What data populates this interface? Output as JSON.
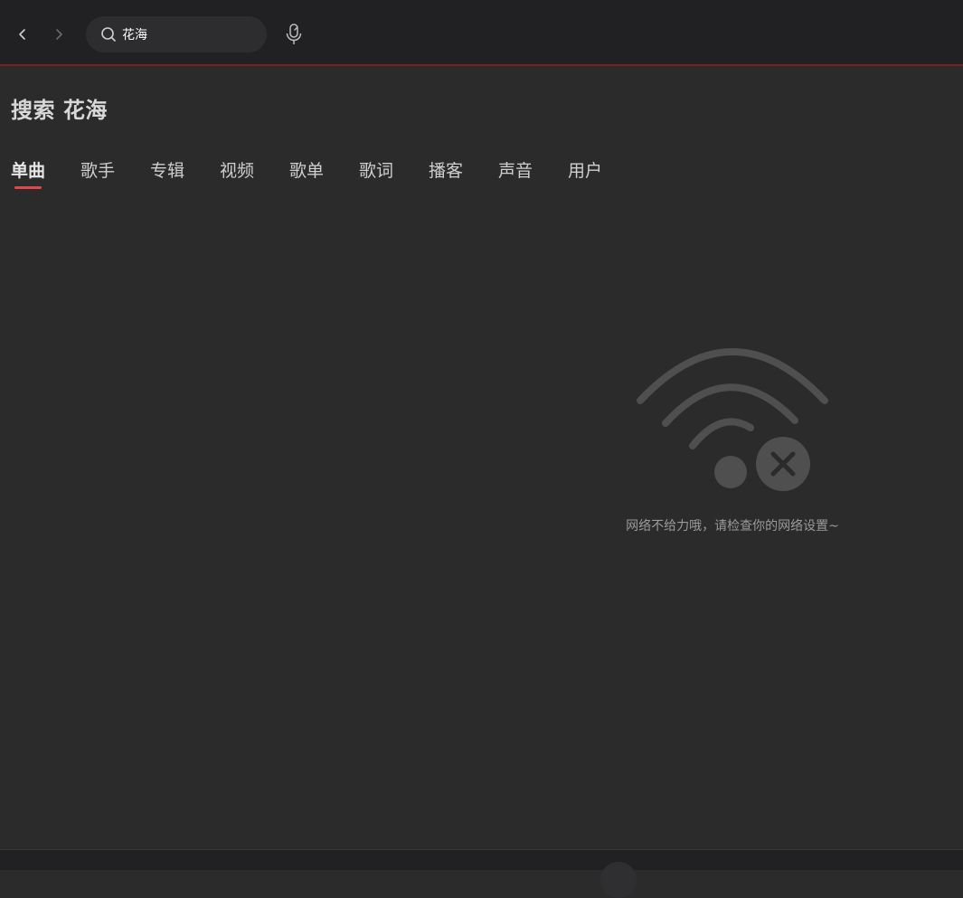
{
  "search": {
    "value": "花海",
    "placeholder": ""
  },
  "header": {
    "title": "搜索 花海"
  },
  "tabs": [
    {
      "label": "单曲",
      "active": true
    },
    {
      "label": "歌手",
      "active": false
    },
    {
      "label": "专辑",
      "active": false
    },
    {
      "label": "视频",
      "active": false
    },
    {
      "label": "歌单",
      "active": false
    },
    {
      "label": "歌词",
      "active": false
    },
    {
      "label": "播客",
      "active": false
    },
    {
      "label": "声音",
      "active": false
    },
    {
      "label": "用户",
      "active": false
    }
  ],
  "empty_state": {
    "icon": "wifi-off-icon",
    "message": "网络不给力哦，请检查你的网络设置~"
  },
  "colors": {
    "background": "#2b2b2b",
    "topbar": "#212124",
    "accent": "#e3474a",
    "topbar_border": "#7a1f22"
  }
}
